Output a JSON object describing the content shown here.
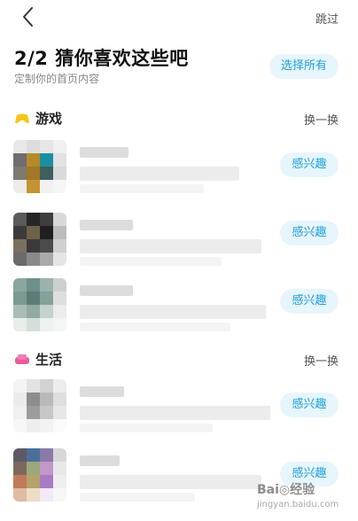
{
  "header": {
    "back_icon": "chevron-left-icon",
    "skip_label": "跳过"
  },
  "page": {
    "title": "2/2 猜你喜欢这些吧",
    "subtitle": "定制你的首页内容",
    "select_all_label": "选择所有"
  },
  "sections": [
    {
      "title": "游戏",
      "icon": "gamepad-icon",
      "icon_color": "#f5c518",
      "refresh_label": "换一换",
      "items": [
        {
          "button_label": "感兴趣"
        },
        {
          "button_label": "感兴趣"
        },
        {
          "button_label": "感兴趣"
        }
      ]
    },
    {
      "title": "生活",
      "icon": "sofa-icon",
      "icon_color": "#ec5a9b",
      "refresh_label": "换一换",
      "items": [
        {
          "button_label": "感兴趣"
        },
        {
          "button_label": "感兴趣"
        }
      ]
    }
  ],
  "colors": {
    "accent": "#1aa0dc",
    "accent_bg": "#e7f5fd"
  }
}
